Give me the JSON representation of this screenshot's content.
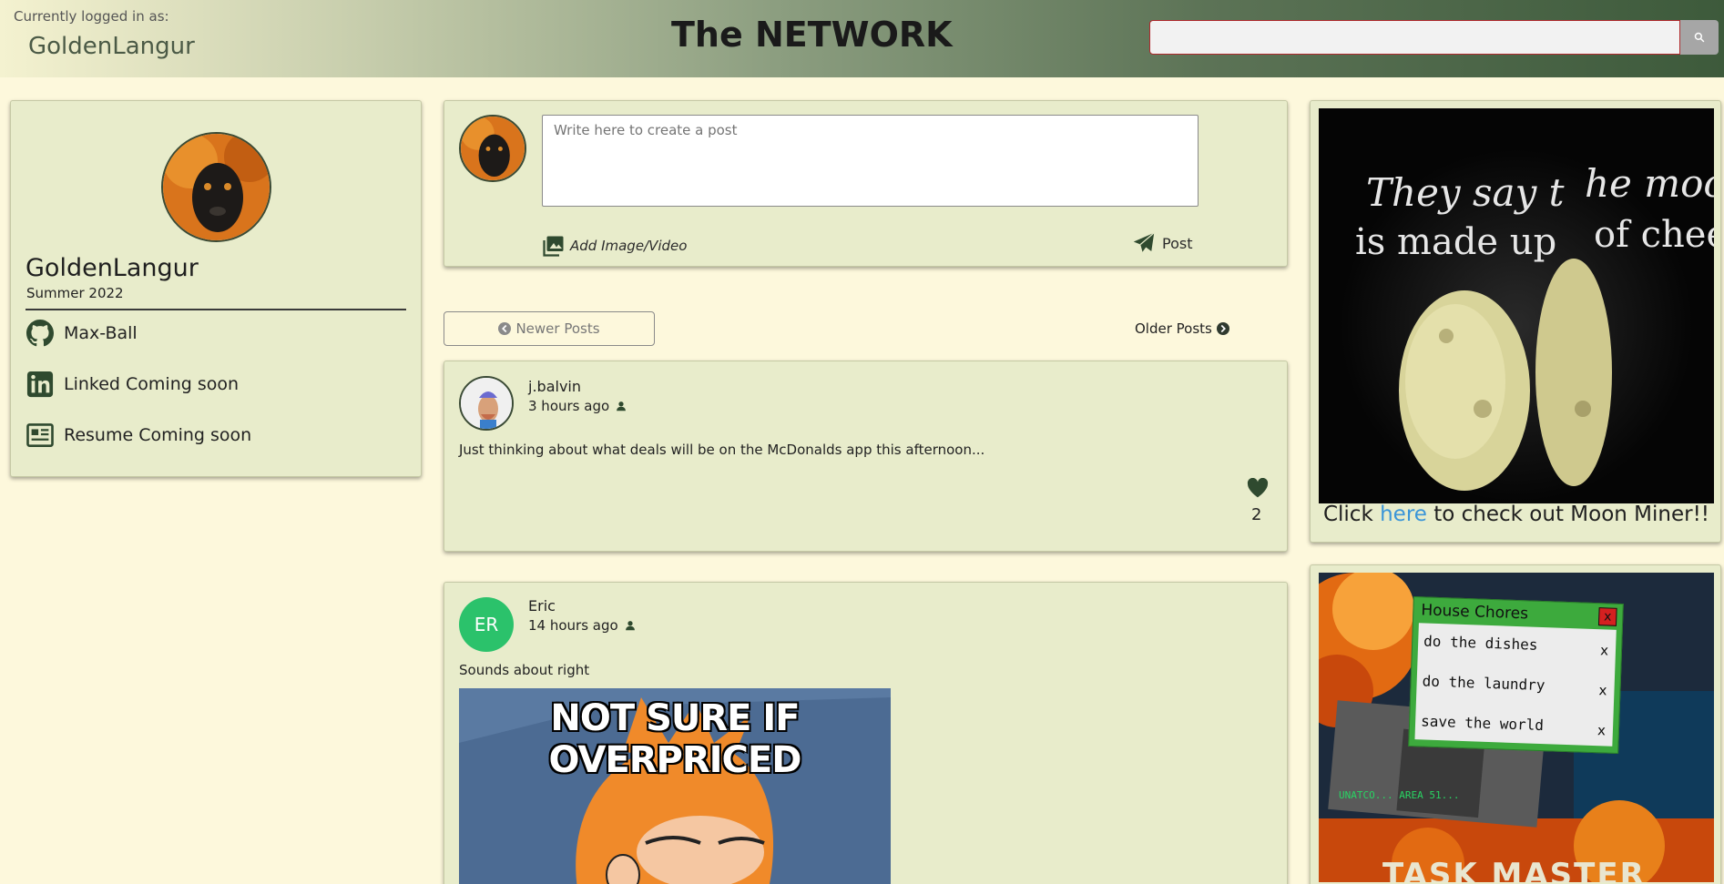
{
  "header": {
    "logged_in_label": "Currently logged in as:",
    "username": "GoldenLangur",
    "site_title": "The NETWORK",
    "search_placeholder": ""
  },
  "profile": {
    "name": "GoldenLangur",
    "class": "Summer 2022",
    "links": [
      {
        "icon": "github-icon",
        "label": "Max-Ball"
      },
      {
        "icon": "linkedin-icon",
        "label": "Linked Coming soon"
      },
      {
        "icon": "resume-icon",
        "label": "Resume Coming soon"
      }
    ]
  },
  "create_post": {
    "placeholder": "Write here to create a post",
    "add_media_label": "Add Image/Video",
    "post_label": "Post"
  },
  "pagination": {
    "newer_label": "Newer Posts",
    "older_label": "Older Posts"
  },
  "posts": [
    {
      "author": "j.balvin",
      "time": "3 hours ago",
      "body": "Just thinking about what deals will be on the McDonalds app this afternoon...",
      "likes": "2"
    },
    {
      "author": "Eric",
      "initials": "ER",
      "time": "14 hours ago",
      "body": "Sounds about right",
      "image_caption": "NOT SURE IF OVERPRICED"
    }
  ],
  "ads": {
    "moon_text_1": "They say t",
    "moon_text_2": "he moon",
    "moon_text_3": "is made up",
    "moon_text_4": "of chees",
    "caption_before": "Click ",
    "caption_link": "here",
    "caption_after": " to check out Moon Miner!!",
    "chores_title": "House Chores",
    "chores_close": "x",
    "chores": [
      "do the dishes",
      "do the laundry",
      "save the world"
    ],
    "chore_delete": "x",
    "task_master_text": "TASK MASTER",
    "terminal_text": "UNATCO... AREA 51..."
  },
  "colors": {
    "accent_green": "#3d5a3b",
    "card_bg": "#e8eccb",
    "page_bg": "#fdf8dc",
    "link_blue": "#3a95d8",
    "avatar_green": "#2bc26b"
  }
}
